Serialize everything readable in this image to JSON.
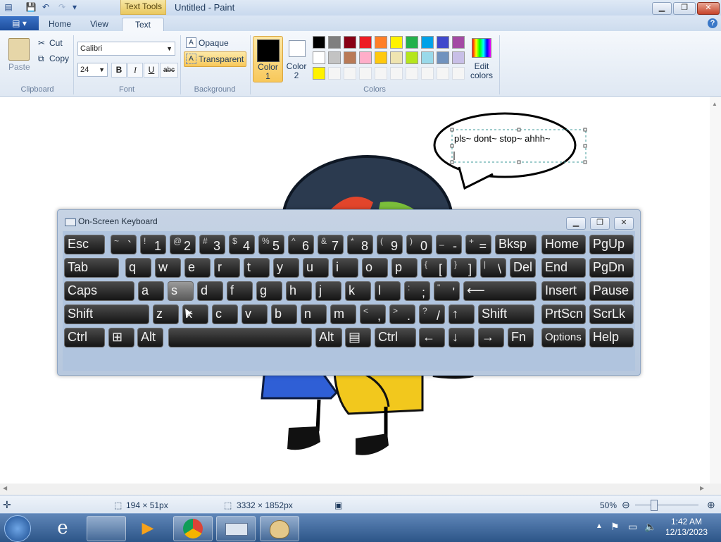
{
  "window": {
    "title": "Untitled - Paint",
    "contextual_tab": "Text Tools",
    "min_icon": "minimize-icon",
    "max_icon": "maximize-icon",
    "close_icon": "close-icon"
  },
  "tabs": {
    "home": "Home",
    "view": "View",
    "text": "Text"
  },
  "clipboard": {
    "paste": "Paste",
    "cut": "Cut",
    "copy": "Copy",
    "group": "Clipboard"
  },
  "font": {
    "family": "Calibri",
    "size": "24",
    "bold": "B",
    "italic": "I",
    "underline": "U",
    "strike": "abc",
    "group": "Font"
  },
  "background": {
    "opaque": "Opaque",
    "transparent": "Transparent",
    "group": "Background"
  },
  "colors": {
    "color1": "Color\n1",
    "color1_a": "Color",
    "color1_b": "1",
    "color2_a": "Color",
    "color2_b": "2",
    "edit_a": "Edit",
    "edit_b": "colors",
    "group": "Colors",
    "color1_value": "#000000",
    "color2_value": "#ffffff",
    "palette_row1": [
      "#000000",
      "#7f7f7f",
      "#880015",
      "#ed1c24",
      "#ff7f27",
      "#fff200",
      "#22b14c",
      "#00a2e8",
      "#3f48cc",
      "#a349a4"
    ],
    "palette_row2": [
      "#ffffff",
      "#c3c3c3",
      "#b97a57",
      "#ffaec9",
      "#ffc90e",
      "#efe4b0",
      "#b5e61d",
      "#99d9ea",
      "#7092be",
      "#c8bfe7"
    ],
    "palette_row3": [
      "#fff200",
      "#f5f5f5",
      "#f5f5f5",
      "#f5f5f5",
      "#f5f5f5",
      "#f5f5f5",
      "#f5f5f5",
      "#f5f5f5",
      "#f5f5f5",
      "#f5f5f5"
    ]
  },
  "canvas": {
    "bubble_text": "pls~ dont~ stop~ ahhh~"
  },
  "osk": {
    "title": "On-Screen Keyboard",
    "rows": [
      [
        {
          "m": "Esc"
        },
        {
          "s": "~",
          "b": "`"
        },
        {
          "s": "!",
          "b": "1"
        },
        {
          "s": "@",
          "b": "2"
        },
        {
          "s": "#",
          "b": "3"
        },
        {
          "s": "$",
          "b": "4"
        },
        {
          "s": "%",
          "b": "5"
        },
        {
          "s": "^",
          "b": "6"
        },
        {
          "s": "&",
          "b": "7"
        },
        {
          "s": "*",
          "b": "8"
        },
        {
          "s": "(",
          "b": "9"
        },
        {
          "s": ")",
          "b": "0"
        },
        {
          "s": "_",
          "b": "-"
        },
        {
          "s": "+",
          "b": "="
        },
        {
          "m": "Bksp"
        },
        {
          "m": "Home"
        },
        {
          "m": "PgUp"
        }
      ],
      [
        {
          "m": "Tab"
        },
        {
          "m": "q"
        },
        {
          "m": "w"
        },
        {
          "m": "e"
        },
        {
          "m": "r"
        },
        {
          "m": "t"
        },
        {
          "m": "y"
        },
        {
          "m": "u"
        },
        {
          "m": "i"
        },
        {
          "m": "o"
        },
        {
          "m": "p"
        },
        {
          "s": "{",
          "b": "["
        },
        {
          "s": "}",
          "b": "]"
        },
        {
          "s": "|",
          "b": "\\"
        },
        {
          "m": "Del"
        },
        {
          "m": "End"
        },
        {
          "m": "PgDn"
        }
      ],
      [
        {
          "m": "Caps"
        },
        {
          "m": "a"
        },
        {
          "m": "s"
        },
        {
          "m": "d"
        },
        {
          "m": "f"
        },
        {
          "m": "g"
        },
        {
          "m": "h"
        },
        {
          "m": "j"
        },
        {
          "m": "k"
        },
        {
          "m": "l"
        },
        {
          "s": ":",
          "b": ";"
        },
        {
          "s": "\"",
          "b": "'"
        },
        {
          "m": "⟵"
        },
        {
          "m": "Insert"
        },
        {
          "m": "Pause"
        }
      ],
      [
        {
          "m": "Shift"
        },
        {
          "m": "z"
        },
        {
          "m": "x"
        },
        {
          "m": "c"
        },
        {
          "m": "v"
        },
        {
          "m": "b"
        },
        {
          "m": "n"
        },
        {
          "m": "m"
        },
        {
          "s": "<",
          "b": ","
        },
        {
          "s": ">",
          "b": "."
        },
        {
          "s": "?",
          "b": "/"
        },
        {
          "m": "↑"
        },
        {
          "m": "Shift"
        },
        {
          "m": "PrtScn"
        },
        {
          "m": "ScrLk"
        }
      ],
      [
        {
          "m": "Ctrl"
        },
        {
          "m": "⊞"
        },
        {
          "m": "Alt"
        },
        {
          "m": ""
        },
        {
          "m": "Alt"
        },
        {
          "m": "▤"
        },
        {
          "m": "Ctrl"
        },
        {
          "m": "←"
        },
        {
          "m": "↓"
        },
        {
          "m": "→"
        },
        {
          "m": "Fn"
        },
        {
          "m": "Options"
        },
        {
          "m": "Help"
        }
      ]
    ]
  },
  "status": {
    "selection_size": "194 × 51px",
    "image_size": "3332 × 1852px",
    "zoom": "50%"
  },
  "taskbar": {
    "time": "1:42 AM",
    "date": "12/13/2023"
  }
}
